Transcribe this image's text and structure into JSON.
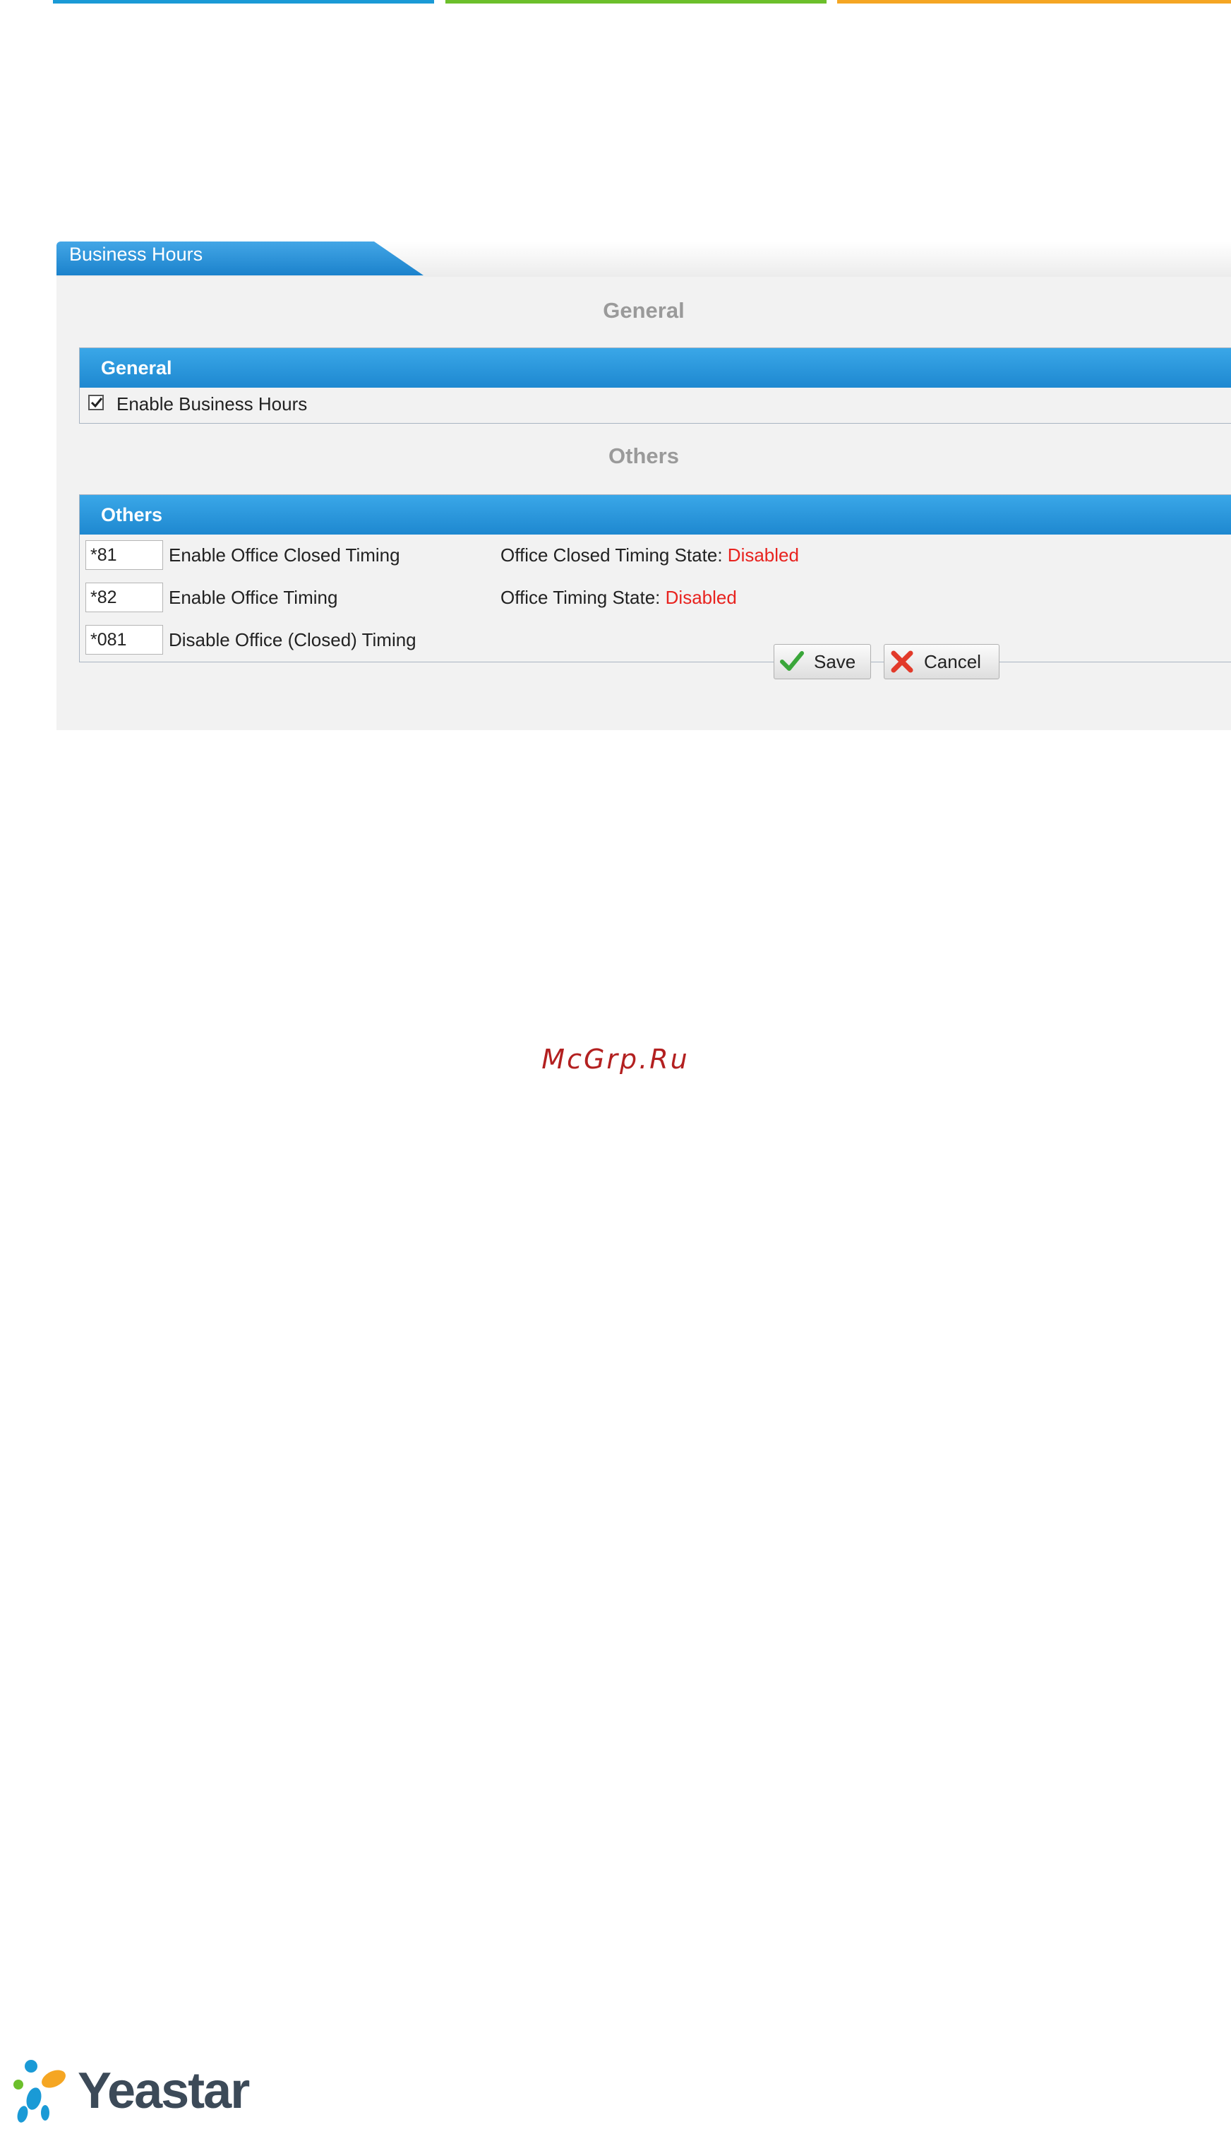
{
  "panel": {
    "tab_title": "Business Hours",
    "general_section_title": "General",
    "general_group": {
      "header": "General",
      "enable_business_hours": {
        "label": "Enable Business Hours",
        "checked": true
      }
    },
    "others_section_title": "Others",
    "others_group": {
      "header": "Others",
      "rows": [
        {
          "code": "*81",
          "label": "Enable Office Closed Timing",
          "state_label": "Office Closed Timing State:",
          "state_value": "Disabled"
        },
        {
          "code": "*82",
          "label": "Enable Office Timing",
          "state_label": "Office Timing State:",
          "state_value": "Disabled"
        },
        {
          "code": "*081",
          "label": "Disable Office (Closed) Timing"
        }
      ]
    },
    "buttons": {
      "save": "Save",
      "cancel": "Cancel"
    }
  },
  "watermark": "McGrp.Ru",
  "logo_text": "Yeastar",
  "colors": {
    "accent_blue": "#1e88d0",
    "state_red": "#e8231f",
    "top_bars": [
      "#1a9ad6",
      "#6cbf2b",
      "#f5a623"
    ]
  }
}
